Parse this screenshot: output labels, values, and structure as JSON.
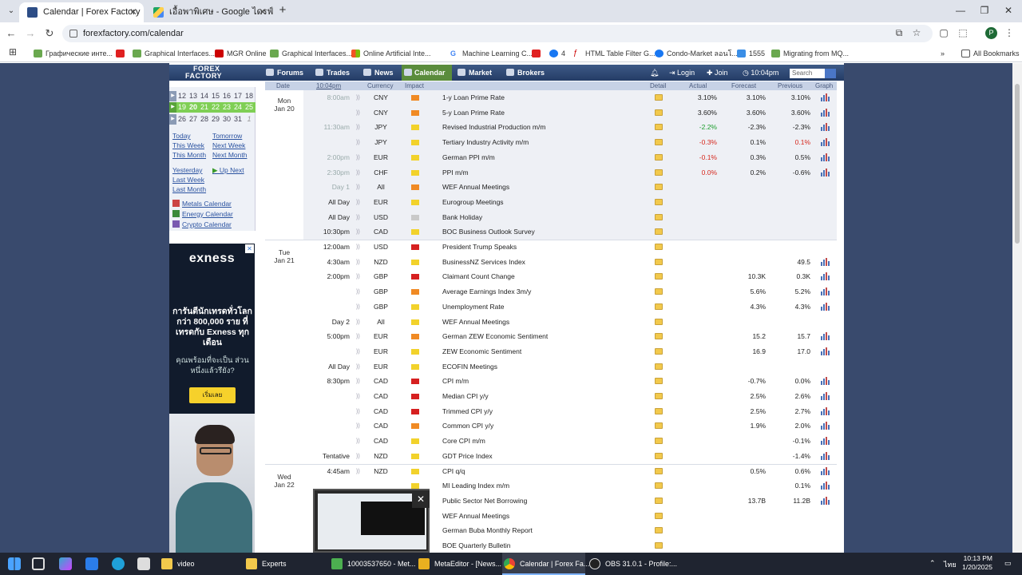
{
  "browser": {
    "tabs": [
      {
        "title": "Calendar | Forex Factory",
        "active": true
      },
      {
        "title": "เอื้อพาพิเศษ - Google ไดรฟ์",
        "active": false
      }
    ],
    "url": "forexfactory.com/calendar",
    "bookmarks": [
      "Графические инте...",
      "Graphical Interfaces...",
      "MGR Online",
      "Graphical Interfaces...",
      "Online Artificial Inte...",
      "Machine Learning C...",
      "4",
      "HTML Table Filter G...",
      "Condo-Market ลอนโ...",
      "1555",
      "Migrating from MQ...",
      "All Bookmarks"
    ],
    "avatar_letter": "P"
  },
  "ff": {
    "logo_line1": "FOREX",
    "logo_line2": "FACTORY",
    "nav": [
      "Forums",
      "Trades",
      "News",
      "Calendar",
      "Market",
      "Brokers"
    ],
    "login": "Login",
    "join": "Join",
    "time": "10:04pm",
    "search_placeholder": "Search"
  },
  "sidebar": {
    "cal_rows": [
      [
        "12",
        "13",
        "14",
        "15",
        "16",
        "17",
        "18"
      ],
      [
        "19",
        "20",
        "21",
        "22",
        "23",
        "24",
        "25"
      ],
      [
        "26",
        "27",
        "28",
        "29",
        "30",
        "31",
        "1"
      ]
    ],
    "links_col1": [
      "Today",
      "This Week",
      "This Month",
      "Yesterday",
      "Last Week",
      "Last Month"
    ],
    "links_col2": [
      "Tomorrow",
      "Next Week",
      "Next Month",
      "Up Next"
    ],
    "calendars": [
      "Metals Calendar",
      "Energy Calendar",
      "Crypto Calendar"
    ]
  },
  "ad": {
    "brand": "exness",
    "headline": "การันตีนักเทรดทั่วโลก กว่า 800,000 ราย ที่เทรดกับ Exness ทุกเดือน",
    "sub": "คุณพร้อมที่จะเป็น ส่วนหนึ่งแล้วรึยัง?",
    "cta": "เริ่มเลย"
  },
  "table": {
    "headers": [
      "Date",
      "10:04pm",
      "Currency",
      "Impact",
      "Detail",
      "Actual",
      "Forecast",
      "Previous",
      "Graph"
    ],
    "days": [
      {
        "day": "Mon",
        "date": "Jan 20"
      },
      {
        "day": "Tue",
        "date": "Jan 21"
      },
      {
        "day": "Wed",
        "date": "Jan 22"
      }
    ],
    "rows": [
      {
        "time": "8:00am",
        "grey": true,
        "cur": "CNY",
        "imp": "ora",
        "ev": "1-y Loan Prime Rate",
        "act": "3.10%",
        "act_c": "",
        "fc": "3.10%",
        "pv": "3.10%",
        "pv_c": "",
        "gr": true,
        "hl": true
      },
      {
        "time": "",
        "grey": true,
        "cur": "CNY",
        "imp": "ora",
        "ev": "5-y Loan Prime Rate",
        "act": "3.60%",
        "act_c": "",
        "fc": "3.60%",
        "pv": "3.60%",
        "pv_c": "",
        "gr": true,
        "hl": true
      },
      {
        "time": "11:30am",
        "grey": true,
        "cur": "JPY",
        "imp": "yel",
        "ev": "Revised Industrial Production m/m",
        "act": "-2.2%",
        "act_c": "pos",
        "fc": "-2.3%",
        "pv": "-2.3%",
        "pv_c": "",
        "gr": true,
        "hl": true
      },
      {
        "time": "",
        "grey": true,
        "cur": "JPY",
        "imp": "yel",
        "ev": "Tertiary Industry Activity m/m",
        "act": "-0.3%",
        "act_c": "neg",
        "fc": "0.1%",
        "pv": "0.1%",
        "pv_c": "neg",
        "gr": true,
        "hl": true
      },
      {
        "time": "2:00pm",
        "grey": true,
        "cur": "EUR",
        "imp": "yel",
        "ev": "German PPI m/m",
        "act": "-0.1%",
        "act_c": "neg",
        "fc": "0.3%",
        "pv": "0.5%",
        "pv_c": "",
        "gr": true,
        "hl": true
      },
      {
        "time": "2:30pm",
        "grey": true,
        "cur": "CHF",
        "imp": "yel",
        "ev": "PPI m/m",
        "act": "0.0%",
        "act_c": "neg",
        "fc": "0.2%",
        "pv": "-0.6%",
        "pv_c": "",
        "gr": true,
        "hl": true
      },
      {
        "time": "Day 1",
        "grey": true,
        "cur": "All",
        "imp": "ora",
        "ev": "WEF Annual Meetings",
        "act": "",
        "act_c": "",
        "fc": "",
        "pv": "",
        "pv_c": "",
        "gr": false,
        "hl": true
      },
      {
        "time": "All Day",
        "grey": false,
        "cur": "EUR",
        "imp": "yel",
        "ev": "Eurogroup Meetings",
        "act": "",
        "act_c": "",
        "fc": "",
        "pv": "",
        "pv_c": "",
        "gr": false,
        "hl": true
      },
      {
        "time": "All Day",
        "grey": false,
        "cur": "USD",
        "imp": "gra",
        "ev": "Bank Holiday",
        "act": "",
        "act_c": "",
        "fc": "",
        "pv": "",
        "pv_c": "",
        "gr": false,
        "hl": true
      },
      {
        "time": "10:30pm",
        "grey": false,
        "cur": "CAD",
        "imp": "yel",
        "ev": "BOC Business Outlook Survey",
        "act": "",
        "act_c": "",
        "fc": "",
        "pv": "",
        "pv_c": "",
        "gr": false,
        "hl": true
      },
      {
        "time": "12:00am",
        "grey": false,
        "cur": "USD",
        "imp": "red",
        "ev": "President Trump Speaks",
        "act": "",
        "act_c": "",
        "fc": "",
        "pv": "",
        "pv_c": "",
        "gr": false,
        "hl": false
      },
      {
        "time": "4:30am",
        "grey": false,
        "cur": "NZD",
        "imp": "yel",
        "ev": "BusinessNZ Services Index",
        "act": "",
        "act_c": "",
        "fc": "",
        "pv": "49.5",
        "pv_c": "",
        "gr": true,
        "hl": false
      },
      {
        "time": "2:00pm",
        "grey": false,
        "cur": "GBP",
        "imp": "red",
        "ev": "Claimant Count Change",
        "act": "",
        "act_c": "",
        "fc": "10.3K",
        "pv": "0.3K",
        "pv_c": "",
        "gr": true,
        "hl": false
      },
      {
        "time": "",
        "grey": false,
        "cur": "GBP",
        "imp": "ora",
        "ev": "Average Earnings Index 3m/y",
        "act": "",
        "act_c": "",
        "fc": "5.6%",
        "pv": "5.2%",
        "pv_c": "",
        "gr": true,
        "hl": false
      },
      {
        "time": "",
        "grey": false,
        "cur": "GBP",
        "imp": "yel",
        "ev": "Unemployment Rate",
        "act": "",
        "act_c": "",
        "fc": "4.3%",
        "pv": "4.3%",
        "pv_c": "",
        "gr": true,
        "hl": false
      },
      {
        "time": "Day 2",
        "grey": false,
        "cur": "All",
        "imp": "yel",
        "ev": "WEF Annual Meetings",
        "act": "",
        "act_c": "",
        "fc": "",
        "pv": "",
        "pv_c": "",
        "gr": false,
        "hl": false
      },
      {
        "time": "5:00pm",
        "grey": false,
        "cur": "EUR",
        "imp": "ora",
        "ev": "German ZEW Economic Sentiment",
        "act": "",
        "act_c": "",
        "fc": "15.2",
        "pv": "15.7",
        "pv_c": "",
        "gr": true,
        "hl": false
      },
      {
        "time": "",
        "grey": false,
        "cur": "EUR",
        "imp": "yel",
        "ev": "ZEW Economic Sentiment",
        "act": "",
        "act_c": "",
        "fc": "16.9",
        "pv": "17.0",
        "pv_c": "",
        "gr": true,
        "hl": false
      },
      {
        "time": "All Day",
        "grey": false,
        "cur": "EUR",
        "imp": "yel",
        "ev": "ECOFIN Meetings",
        "act": "",
        "act_c": "",
        "fc": "",
        "pv": "",
        "pv_c": "",
        "gr": false,
        "hl": false
      },
      {
        "time": "8:30pm",
        "grey": false,
        "cur": "CAD",
        "imp": "red",
        "ev": "CPI m/m",
        "act": "",
        "act_c": "",
        "fc": "-0.7%",
        "pv": "0.0%",
        "pv_c": "",
        "gr": true,
        "hl": false
      },
      {
        "time": "",
        "grey": false,
        "cur": "CAD",
        "imp": "red",
        "ev": "Median CPI y/y",
        "act": "",
        "act_c": "",
        "fc": "2.5%",
        "pv": "2.6%",
        "pv_c": "",
        "gr": true,
        "hl": false
      },
      {
        "time": "",
        "grey": false,
        "cur": "CAD",
        "imp": "red",
        "ev": "Trimmed CPI y/y",
        "act": "",
        "act_c": "",
        "fc": "2.5%",
        "pv": "2.7%",
        "pv_c": "",
        "gr": true,
        "hl": false
      },
      {
        "time": "",
        "grey": false,
        "cur": "CAD",
        "imp": "ora",
        "ev": "Common CPI y/y",
        "act": "",
        "act_c": "",
        "fc": "1.9%",
        "pv": "2.0%",
        "pv_c": "",
        "gr": true,
        "hl": false
      },
      {
        "time": "",
        "grey": false,
        "cur": "CAD",
        "imp": "yel",
        "ev": "Core CPI m/m",
        "act": "",
        "act_c": "",
        "fc": "",
        "pv": "-0.1%",
        "pv_c": "",
        "gr": true,
        "hl": false
      },
      {
        "time": "Tentative",
        "grey": false,
        "cur": "NZD",
        "imp": "yel",
        "ev": "GDT Price Index",
        "act": "",
        "act_c": "",
        "fc": "",
        "pv": "-1.4%",
        "pv_c": "",
        "gr": true,
        "hl": false
      },
      {
        "time": "4:45am",
        "grey": false,
        "cur": "NZD",
        "imp": "yel",
        "ev": "CPI q/q",
        "act": "",
        "act_c": "",
        "fc": "0.5%",
        "pv": "0.6%",
        "pv_c": "",
        "gr": true,
        "hl": false
      },
      {
        "time": "",
        "grey": false,
        "cur": "",
        "imp": "yel",
        "ev": "MI Leading Index m/m",
        "act": "",
        "act_c": "",
        "fc": "",
        "pv": "0.1%",
        "pv_c": "",
        "gr": true,
        "hl": false
      },
      {
        "time": "",
        "grey": false,
        "cur": "",
        "imp": "yel",
        "ev": "Public Sector Net Borrowing",
        "act": "",
        "act_c": "",
        "fc": "13.7B",
        "pv": "11.2B",
        "pv_c": "",
        "gr": true,
        "hl": false
      },
      {
        "time": "",
        "grey": false,
        "cur": "",
        "imp": "yel",
        "ev": "WEF Annual Meetings",
        "act": "",
        "act_c": "",
        "fc": "",
        "pv": "",
        "pv_c": "",
        "gr": false,
        "hl": false
      },
      {
        "time": "",
        "grey": false,
        "cur": "",
        "imp": "yel",
        "ev": "German Buba Monthly Report",
        "act": "",
        "act_c": "",
        "fc": "",
        "pv": "",
        "pv_c": "",
        "gr": false,
        "hl": false
      },
      {
        "time": "",
        "grey": false,
        "cur": "",
        "imp": "yel",
        "ev": "BOE Quarterly Bulletin",
        "act": "",
        "act_c": "",
        "fc": "",
        "pv": "",
        "pv_c": "",
        "gr": false,
        "hl": false
      }
    ]
  },
  "taskbar": {
    "apps": [
      "video",
      "Experts",
      "10003537650 - Met...",
      "MetaEditor - [News...",
      "Calendar | Forex Fa...",
      "OBS 31.0.1 - Profile:..."
    ],
    "lang": "ไทย",
    "time": "10:13 PM",
    "date": "1/20/2025"
  },
  "colors": {
    "page_bg": "#394a6d",
    "nav_bg": "#2f4a77",
    "calendar_active": "#5a8c3c",
    "impact_red": "#d62020",
    "impact_orange": "#f08a24",
    "impact_yellow": "#f2d22b"
  }
}
